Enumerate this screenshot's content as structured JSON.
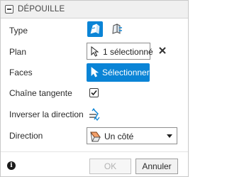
{
  "dialog": {
    "title": "DÉPOUILLE",
    "rows": {
      "type_label": "Type",
      "plan_label": "Plan",
      "faces_label": "Faces",
      "tangent_chain_label": "Chaîne tangente",
      "flip_direction_label": "Inverser la direction",
      "direction_label": "Direction"
    },
    "plan": {
      "value": "1 sélectionné"
    },
    "faces": {
      "button_label": "Sélectionner"
    },
    "tangent_chain": {
      "checked": true
    },
    "direction": {
      "selected": "Un côté"
    },
    "type": {
      "options": [
        {
          "icon": "fixed-plane-draft-icon",
          "active": true
        },
        {
          "icon": "parting-line-draft-icon",
          "active": false
        }
      ]
    },
    "footer": {
      "ok_label": "OK",
      "cancel_label": "Annuler"
    }
  },
  "colors": {
    "accent": "#0a84d6",
    "disabled_text": "#b3b3b3"
  }
}
